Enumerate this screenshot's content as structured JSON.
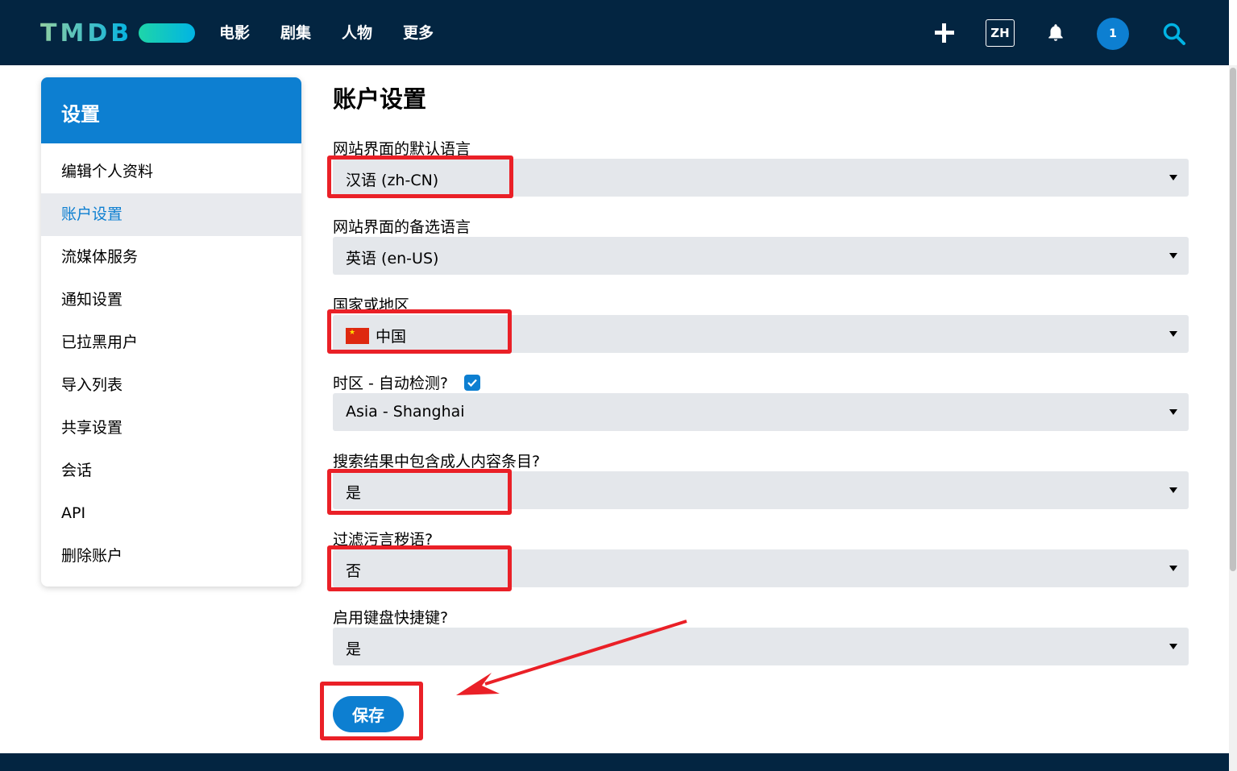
{
  "header": {
    "logo": "TMDB",
    "nav": [
      "电影",
      "剧集",
      "人物",
      "更多"
    ],
    "language_badge": "ZH",
    "avatar_letter": "1"
  },
  "sidebar": {
    "title": "设置",
    "items": [
      {
        "label": "编辑个人资料",
        "active": false
      },
      {
        "label": "账户设置",
        "active": true
      },
      {
        "label": "流媒体服务",
        "active": false
      },
      {
        "label": "通知设置",
        "active": false
      },
      {
        "label": "已拉黑用户",
        "active": false
      },
      {
        "label": "导入列表",
        "active": false
      },
      {
        "label": "共享设置",
        "active": false
      },
      {
        "label": "会话",
        "active": false
      },
      {
        "label": "API",
        "active": false
      },
      {
        "label": "删除账户",
        "active": false
      }
    ]
  },
  "main": {
    "title": "账户设置",
    "fields": {
      "default_language": {
        "label": "网站界面的默认语言",
        "value": "汉语 (zh-CN)"
      },
      "fallback_language": {
        "label": "网站界面的备选语言",
        "value": "英语 (en-US)"
      },
      "country": {
        "label": "国家或地区",
        "value": "中国"
      },
      "timezone": {
        "label": "时区 - 自动检测?",
        "value": "Asia - Shanghai",
        "auto_detect": true
      },
      "adult_content": {
        "label": "搜索结果中包含成人内容条目?",
        "value": "是"
      },
      "filter_profanity": {
        "label": "过滤污言秽语?",
        "value": "否"
      },
      "keyboard_shortcuts": {
        "label": "启用键盘快捷键?",
        "value": "是"
      }
    },
    "save_label": "保存"
  },
  "colors": {
    "header_bg": "#032541",
    "accent": "#0d7fd1",
    "select_bg": "#e4e7eb",
    "annotation": "#ea2027"
  }
}
